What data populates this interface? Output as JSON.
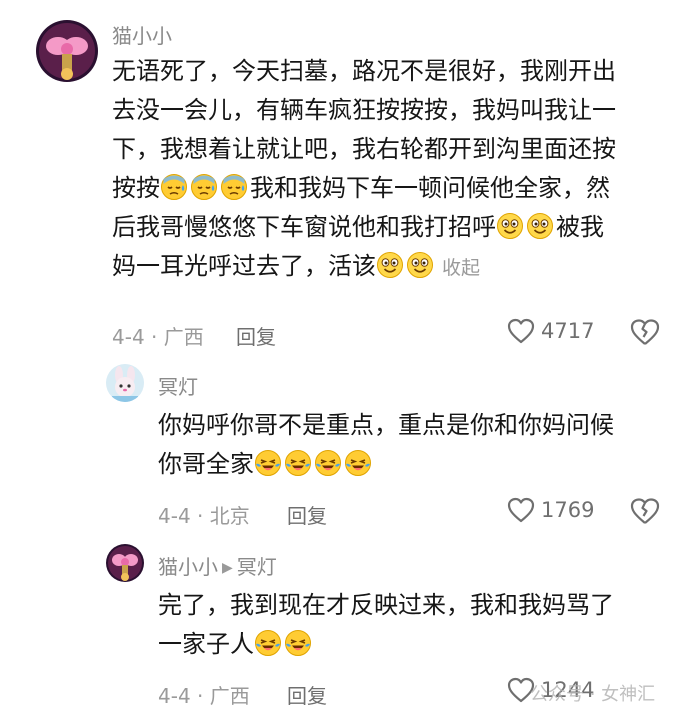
{
  "comments": [
    {
      "username": "猫小小",
      "paragraph": [
        {
          "t": "text",
          "v": "无语死了，今天扫墓，路况不是很好，我刚开出"
        },
        {
          "t": "br"
        },
        {
          "t": "text",
          "v": "去没一会儿，有辆车疯狂按按按，我妈叫我让一"
        },
        {
          "t": "br"
        },
        {
          "t": "text",
          "v": "下，我想着让就让吧，我右轮都开到沟里面还按"
        },
        {
          "t": "br"
        },
        {
          "t": "text",
          "v": "按按"
        },
        {
          "t": "emoji",
          "v": "sweat-face-emoji"
        },
        {
          "t": "emoji",
          "v": "sweat-face-emoji"
        },
        {
          "t": "emoji",
          "v": "sweat-face-emoji"
        },
        {
          "t": "text",
          "v": "我和我妈下车一顿问候他全家，然"
        },
        {
          "t": "br"
        },
        {
          "t": "text",
          "v": "后我哥慢悠悠下车窗说他和我打招呼"
        },
        {
          "t": "emoji",
          "v": "grin-face-emoji"
        },
        {
          "t": "emoji",
          "v": "grin-face-emoji"
        },
        {
          "t": "text",
          "v": "被我"
        },
        {
          "t": "br"
        },
        {
          "t": "text",
          "v": "妈一耳光呼过去了，活该"
        },
        {
          "t": "emoji",
          "v": "grin-face-emoji"
        },
        {
          "t": "emoji",
          "v": "grin-face-emoji"
        },
        {
          "t": "collapse",
          "v": "收起"
        }
      ],
      "date_location": "4-4 · 广西",
      "reply_label": "回复",
      "likes": "4717"
    },
    {
      "username": "冥灯",
      "paragraph": [
        {
          "t": "text",
          "v": "你妈呼你哥不是重点，重点是你和你妈问候"
        },
        {
          "t": "br"
        },
        {
          "t": "text",
          "v": "你哥全家"
        },
        {
          "t": "emoji",
          "v": "laugh-cry-emoji"
        },
        {
          "t": "emoji",
          "v": "laugh-cry-emoji"
        },
        {
          "t": "emoji",
          "v": "laugh-cry-emoji"
        },
        {
          "t": "emoji",
          "v": "laugh-cry-emoji"
        }
      ],
      "date_location": "4-4 · 北京",
      "reply_label": "回复",
      "likes": "1769"
    },
    {
      "username": "猫小小",
      "reply_to": "冥灯",
      "paragraph": [
        {
          "t": "text",
          "v": "完了，我到现在才反映过来，我和我妈骂了"
        },
        {
          "t": "br"
        },
        {
          "t": "text",
          "v": "一家子人"
        },
        {
          "t": "emoji",
          "v": "laugh-cry-emoji"
        },
        {
          "t": "emoji",
          "v": "laugh-cry-emoji"
        }
      ],
      "date_location": "4-4 · 广西",
      "reply_label": "回复",
      "likes": "1244"
    }
  ],
  "watermark": "公众号 · 女神汇",
  "colors": {
    "accent_pink": "#e86aa8",
    "muted_text": "#9a9a9a",
    "emoji_yellow": "#ffcc33"
  }
}
